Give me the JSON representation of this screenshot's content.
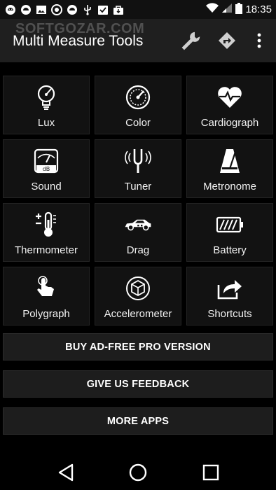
{
  "status_bar": {
    "time": "18:35",
    "left_icons": [
      "android-debug-icon",
      "android-icon",
      "image-icon",
      "record-icon",
      "android-icon",
      "usb-icon",
      "download-check-icon",
      "bag-icon"
    ],
    "right_icons": [
      "wifi-icon",
      "signal-icon",
      "battery-icon"
    ]
  },
  "toolbar": {
    "title": "Multi Measure Tools",
    "watermark": "SOFTGOZAR.COM",
    "actions": [
      "wrench-icon",
      "directions-icon",
      "overflow-menu-icon"
    ]
  },
  "tools": [
    {
      "label": "Lux",
      "icon": "lightbulb-gauge-icon"
    },
    {
      "label": "Color",
      "icon": "color-meter-icon"
    },
    {
      "label": "Cardiograph",
      "icon": "heart-pulse-icon"
    },
    {
      "label": "Sound",
      "icon": "decibel-meter-icon"
    },
    {
      "label": "Tuner",
      "icon": "tuning-fork-icon"
    },
    {
      "label": "Metronome",
      "icon": "metronome-icon"
    },
    {
      "label": "Thermometer",
      "icon": "thermometer-icon"
    },
    {
      "label": "Drag",
      "icon": "race-car-icon"
    },
    {
      "label": "Battery",
      "icon": "battery-icon"
    },
    {
      "label": "Polygraph",
      "icon": "finger-touch-icon"
    },
    {
      "label": "Accelerometer",
      "icon": "cube-axes-icon"
    },
    {
      "label": "Shortcuts",
      "icon": "share-icon"
    }
  ],
  "buttons": {
    "pro": "BUY AD-FREE PRO VERSION",
    "feedback": "GIVE US FEEDBACK",
    "more_apps": "MORE APPS"
  },
  "nav_bar": [
    "back-icon",
    "home-icon",
    "recents-icon"
  ]
}
